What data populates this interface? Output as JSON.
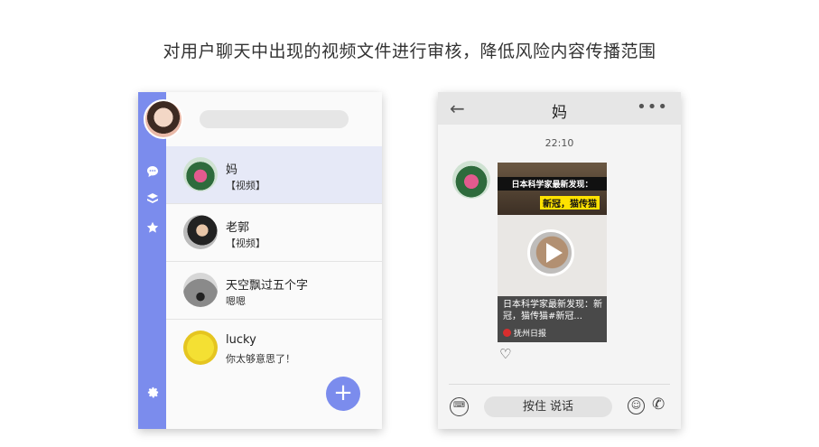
{
  "caption": "对用户聊天中出现的视频文件进行审核，降低风险内容传播范围",
  "left_phone": {
    "rail_icons": [
      "chat-bubble-icon",
      "layers-icon",
      "star-icon",
      "gear-icon"
    ],
    "chats": [
      {
        "name": "妈",
        "preview": "【视频】",
        "active": true
      },
      {
        "name": "老郭",
        "preview": "【视频】",
        "active": false
      },
      {
        "name": "天空飘过五个字",
        "preview": "嗯嗯",
        "active": false
      },
      {
        "name": "lucky",
        "preview": "你太够意思了！",
        "active": false
      }
    ],
    "fab_label": "+"
  },
  "right_phone": {
    "back_glyph": "←",
    "title": "妈",
    "more_glyph": "•••",
    "time": "22:10",
    "card": {
      "headline_1": "日本科学家最新发现：",
      "headline_2": "新冠，猫传猫",
      "description": "日本科学家最新发现：新冠，猫传猫#新冠...",
      "source": "抚州日报"
    },
    "heart_glyph": "♡",
    "voice_label": "按住 说话",
    "keyboard_glyph": "⌨",
    "emoji_glyph": "☺",
    "phone_glyph": "✆"
  },
  "colors": {
    "accent": "#7b8ced",
    "active_row": "#e6e9f7"
  }
}
